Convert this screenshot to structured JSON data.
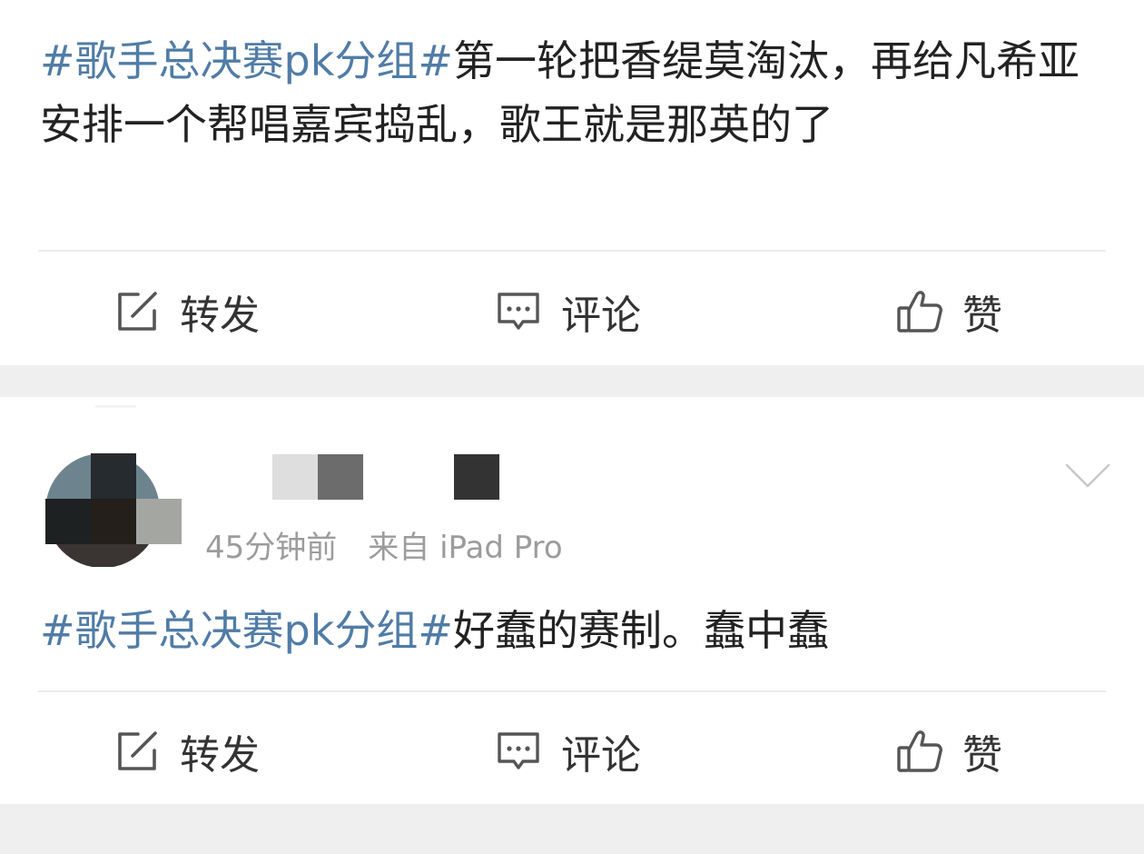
{
  "posts": [
    {
      "topic": "#歌手总决赛pk分组#",
      "text": "第一轮把香缇莫淘汰，再给凡希亚安排一个帮唱嘉宾捣乱，歌王就是那英的了",
      "actions": {
        "repost": "转发",
        "comment": "评论",
        "like": "赞"
      }
    },
    {
      "time": "45分钟前",
      "source": "来自 iPad Pro",
      "topic": "#歌手总决赛pk分组#",
      "text": "好蠢的赛制。蠢中蠢",
      "actions": {
        "repost": "转发",
        "comment": "评论",
        "like": "赞"
      }
    }
  ],
  "icons": {
    "repost": "edit-square-icon",
    "comment": "comment-bubble-icon",
    "like": "thumbs-up-icon",
    "menu": "chevron-down-icon"
  },
  "colors": {
    "topic": "#507ca6",
    "text": "#222222",
    "meta": "#9c9c9c",
    "background": "#efefef",
    "card": "#ffffff"
  }
}
